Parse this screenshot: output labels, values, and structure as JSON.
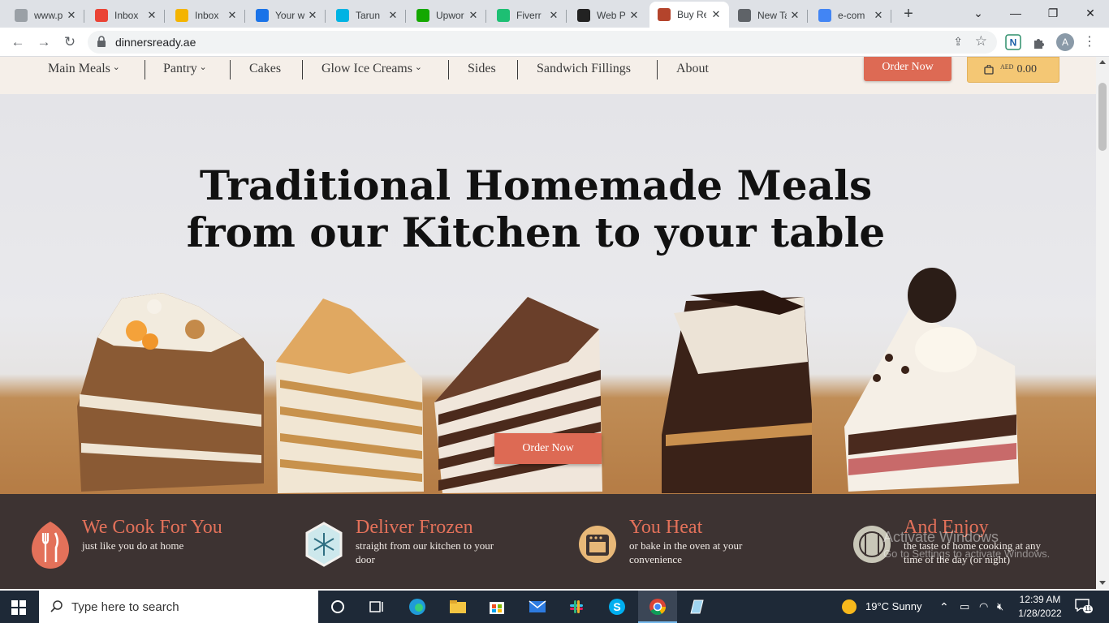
{
  "browser": {
    "tabs": [
      {
        "title": "www.p",
        "fav_color": "#9aa0a6",
        "icon": "generic-icon"
      },
      {
        "title": "Inbox",
        "fav_color": "#ea4335",
        "icon": "gmail-icon"
      },
      {
        "title": "Inbox",
        "fav_color": "#f4b400",
        "icon": "mail-icon"
      },
      {
        "title": "Your w",
        "fav_color": "#1a73e8",
        "icon": "jira-icon"
      },
      {
        "title": "Tarun",
        "fav_color": "#00b3e3",
        "icon": "tarun-icon"
      },
      {
        "title": "Upwor",
        "fav_color": "#14a800",
        "icon": "upwork-icon"
      },
      {
        "title": "Fiverr",
        "fav_color": "#1dbf73",
        "icon": "fiverr-icon"
      },
      {
        "title": "Web P",
        "fav_color": "#222222",
        "icon": "wode-icon"
      },
      {
        "title": "Buy Re",
        "fav_color": "#b4442c",
        "icon": "cake-icon"
      },
      {
        "title": "New Ta",
        "fav_color": "#5f6368",
        "icon": "chrome-icon"
      },
      {
        "title": "e-com",
        "fav_color": "#4285f4",
        "icon": "google-icon"
      }
    ],
    "active_tab_index": 8,
    "url": "dinnersready.ae",
    "profile_initial": "A"
  },
  "site": {
    "nav": [
      "Main Meals",
      "Pantry",
      "Cakes",
      "Glow Ice Creams",
      "Sides",
      "Sandwich Fillings",
      "About"
    ],
    "nav_dropdowns": [
      true,
      true,
      false,
      true,
      false,
      false,
      false
    ],
    "order_button": "Order Now",
    "cart_currency": "AED",
    "cart_amount": "0.00",
    "hero_line1": "Traditional Homemade Meals",
    "hero_line2": "from our Kitchen to your table",
    "hero_button": "Order Now",
    "accent_color": "#dd6a54",
    "cart_color": "#f4c774"
  },
  "features": [
    {
      "title": "We Cook For You",
      "desc": "just like you do at home",
      "icon": "fork-knife-icon"
    },
    {
      "title": "Deliver Frozen",
      "desc": "straight from our kitchen to your door",
      "icon": "snowflake-icon"
    },
    {
      "title": "You Heat",
      "desc": "or bake in the oven at your convenience",
      "icon": "oven-icon"
    },
    {
      "title": "And Enjoy",
      "desc": "the taste of home cooking at any time of the day (or night)",
      "icon": "plate-icon"
    }
  ],
  "watermark": {
    "line1": "Activate Windows",
    "line2": "Go to Settings to activate Windows."
  },
  "taskbar": {
    "search_placeholder": "Type here to search",
    "weather": "19°C  Sunny",
    "time": "12:39 AM",
    "date": "1/28/2022",
    "notif_count": "11"
  }
}
